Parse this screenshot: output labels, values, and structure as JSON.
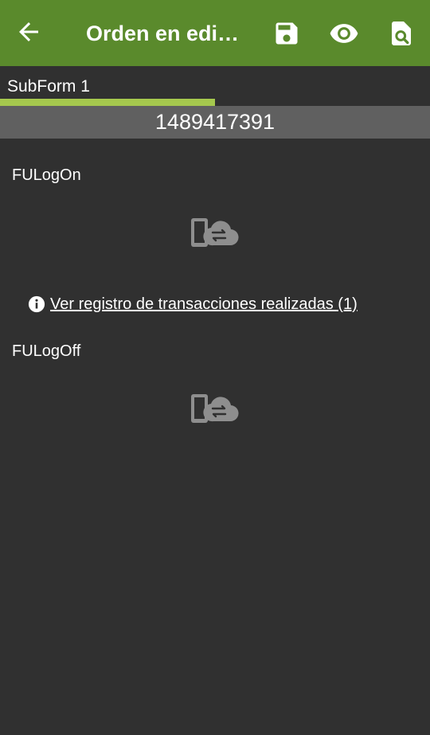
{
  "appbar": {
    "title": "Orden en edi…",
    "back_icon": "arrow-left-icon",
    "actions": [
      {
        "icon": "save-icon"
      },
      {
        "icon": "eye-icon"
      },
      {
        "icon": "document-search-icon"
      }
    ],
    "color": "#5a8a2c"
  },
  "tabs": {
    "active_label": "SubForm 1",
    "indicator_color": "#a5c84e"
  },
  "record": {
    "id": "1489417391"
  },
  "fields": [
    {
      "label": "FULogOn",
      "icon": "device-cloud-sync-icon"
    },
    {
      "label": "FULogOff",
      "icon": "device-cloud-sync-icon"
    }
  ],
  "transactions_link": {
    "icon": "info-icon",
    "text": "Ver registro de transacciones realizadas (1)"
  }
}
